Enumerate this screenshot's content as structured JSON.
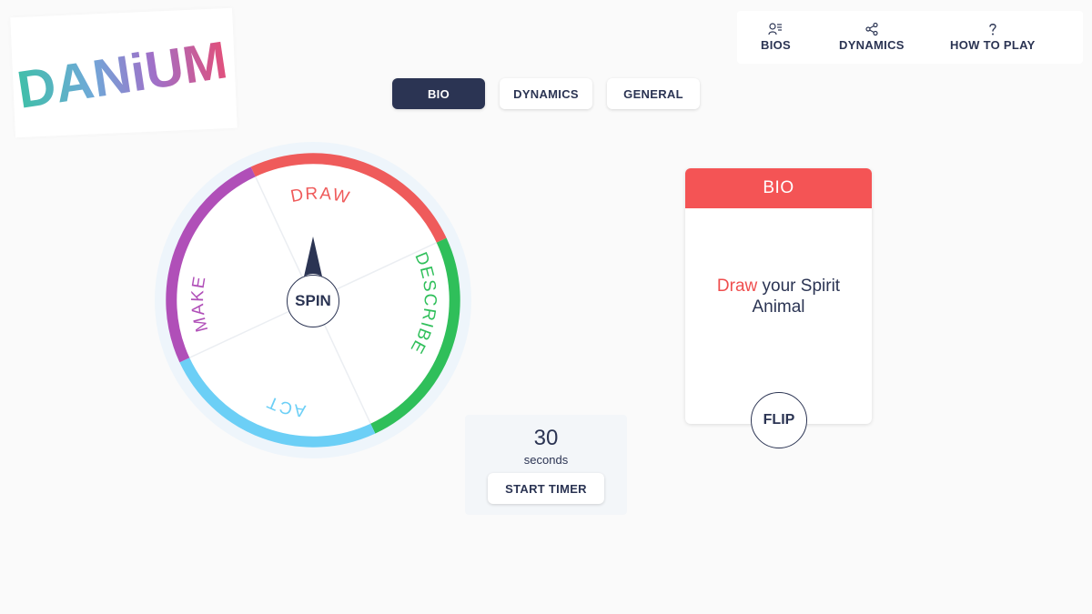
{
  "logo": {
    "text": "DANiUM"
  },
  "nav": {
    "items": [
      {
        "label": "BIOS",
        "icon": "person-list-icon"
      },
      {
        "label": "DYNAMICS",
        "icon": "share-nodes-icon"
      },
      {
        "label": "HOW TO PLAY",
        "icon": "question-mark-icon"
      }
    ]
  },
  "tabs": [
    {
      "label": "BIO",
      "active": true
    },
    {
      "label": "DYNAMICS",
      "active": false
    },
    {
      "label": "GENERAL",
      "active": false
    }
  ],
  "wheel": {
    "segments": [
      {
        "label": "DRAW",
        "color": "#ef5b5b"
      },
      {
        "label": "DESCRIBE",
        "color": "#2fbf5a"
      },
      {
        "label": "ACT",
        "color": "#6ccff6"
      },
      {
        "label": "MAKE",
        "color": "#b04fb8"
      }
    ],
    "spin_label": "SPIN"
  },
  "timer": {
    "value": "30",
    "unit": "seconds",
    "start_label": "START TIMER"
  },
  "card": {
    "header": "BIO",
    "prompt_accent": "Draw",
    "prompt_rest": " your Spirit Animal",
    "flip_label": "FLIP",
    "header_color": "#f45455"
  },
  "colors": {
    "navy": "#2b3453",
    "background": "#fafafa"
  }
}
